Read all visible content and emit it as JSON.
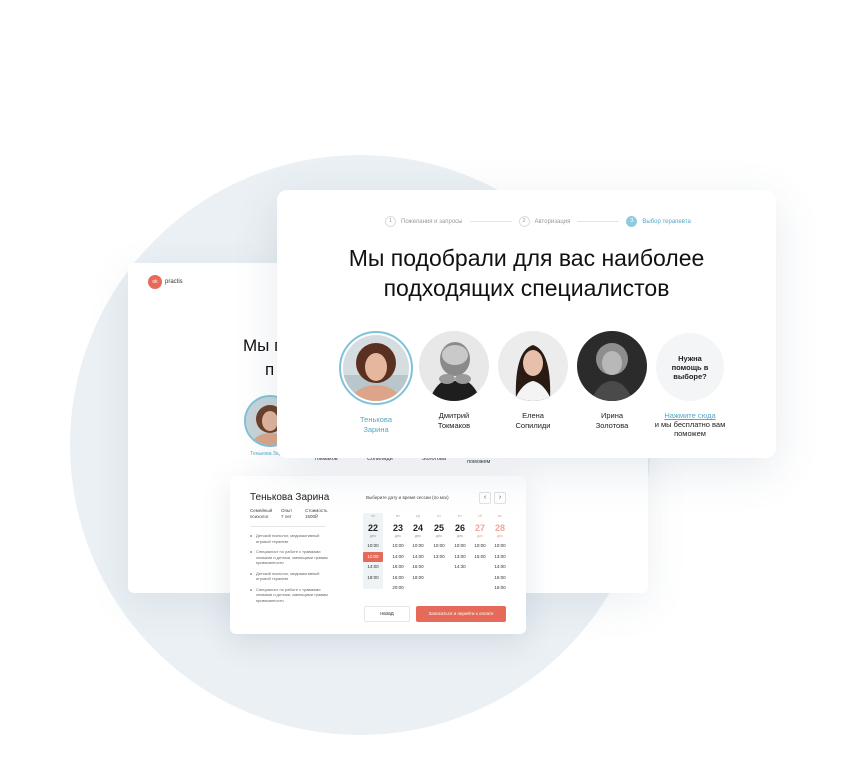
{
  "back_page": {
    "logo_text": "practis",
    "title_line1": "Мы п",
    "title_line2": "п",
    "therapist_name": "Тенькова Зарина",
    "tabs": [
      "Токмаков",
      "Сопилиди",
      "Золотова",
      "и мы бесплатно вам поможем"
    ]
  },
  "booking": {
    "name": "Тенькова Зарина",
    "meta": [
      {
        "label": "Семейный психолог",
        "value": ""
      },
      {
        "label": "Опыт",
        "value": "7 лет"
      },
      {
        "label": "Стоимость",
        "value": "1500₽"
      }
    ],
    "specialties": [
      "Детский психолог, медиаактивный игровой терапевт",
      "Специалист по работе с травмами семьями и детьми, имеющими травмы привязанности",
      "Детский психолог, медиаактивный игровой терапевт",
      "Специалист по работе с травмами семьями и детьми, имеющими травмы привязанности"
    ],
    "date_label": "Выберите дату и время сессии (по мск)",
    "days": [
      {
        "weekday": "пн",
        "day": "22",
        "month": "дек",
        "slots": [
          "10:00",
          "11:00",
          "14:00",
          "18:00"
        ],
        "active_slot": 1,
        "selected": true,
        "weekend": false
      },
      {
        "weekday": "вт",
        "day": "23",
        "month": "дек",
        "slots": [
          "10:00",
          "14:00",
          "16:00",
          "16:00",
          "20:00"
        ],
        "selected": false,
        "weekend": false
      },
      {
        "weekday": "ср",
        "day": "24",
        "month": "дек",
        "slots": [
          "10:00",
          "14:00",
          "16:00",
          "18:00"
        ],
        "selected": false,
        "weekend": false
      },
      {
        "weekday": "чт",
        "day": "25",
        "month": "дек",
        "slots": [
          "10:00",
          "13:00"
        ],
        "selected": false,
        "weekend": false
      },
      {
        "weekday": "пт",
        "day": "26",
        "month": "дек",
        "slots": [
          "10:00",
          "13:00",
          "14:30"
        ],
        "selected": false,
        "weekend": false
      },
      {
        "weekday": "сб",
        "day": "27",
        "month": "дек",
        "slots": [
          "10:00",
          "15:00"
        ],
        "selected": false,
        "weekend": true
      },
      {
        "weekday": "вс",
        "day": "28",
        "month": "дек",
        "slots": [
          "10:00",
          "13:00",
          "14:00",
          "16:00",
          "16:00"
        ],
        "selected": false,
        "weekend": true
      }
    ],
    "back_label": "назад",
    "submit_label": "Записаться и перейти к оплате"
  },
  "front": {
    "steps": [
      {
        "num": "1",
        "label": "Пожелания и запросы",
        "active": false
      },
      {
        "num": "2",
        "label": "Авторизация",
        "active": false
      },
      {
        "num": "3",
        "label": "Выбор терапевта",
        "active": true
      }
    ],
    "title_line1": "Мы подобрали для вас наиболее",
    "title_line2": "подходящих специалистов",
    "specialists": [
      {
        "first": "Тенькова",
        "last": "Зарина",
        "selected": true
      },
      {
        "first": "Дмитрий",
        "last": "Токмаков",
        "selected": false
      },
      {
        "first": "Елена",
        "last": "Сопилиди",
        "selected": false
      },
      {
        "first": "Ирина",
        "last": "Золотова",
        "selected": false
      }
    ],
    "help_title": "Нужна помощь в выборе?",
    "help_link": "Нажмите сюда",
    "help_text": "и мы бесплатно вам поможем"
  }
}
